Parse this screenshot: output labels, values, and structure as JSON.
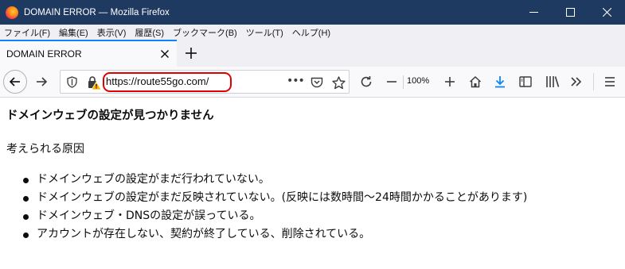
{
  "window": {
    "title": "DOMAIN ERROR — Mozilla Firefox"
  },
  "menubar": {
    "items": [
      "ファイル(F)",
      "編集(E)",
      "表示(V)",
      "履歴(S)",
      "ブックマーク(B)",
      "ツール(T)",
      "ヘルプ(H)"
    ]
  },
  "tabs": [
    {
      "label": "DOMAIN ERROR",
      "active": true
    }
  ],
  "urlbar": {
    "url": "https://route55go.com/",
    "highlight_color": "#e00000"
  },
  "toolbar": {
    "zoom_level": "100%",
    "download_icon_color": "#0a84ff"
  },
  "page": {
    "heading": "ドメインウェブの設定が見つかりません",
    "causes_heading": "考えられる原因",
    "causes": [
      "ドメインウェブの設定がまだ行われていない。",
      "ドメインウェブの設定がまだ反映されていない。(反映には数時間～24時間かかることがあります)",
      "ドメインウェブ・DNSの設定が誤っている。",
      "アカウントが存在しない、契約が終了している、削除されている。"
    ]
  },
  "colors": {
    "titlebar": "#1f3a60",
    "tab_accent": "#0a84ff",
    "chrome_bg": "#f0f0f4"
  }
}
